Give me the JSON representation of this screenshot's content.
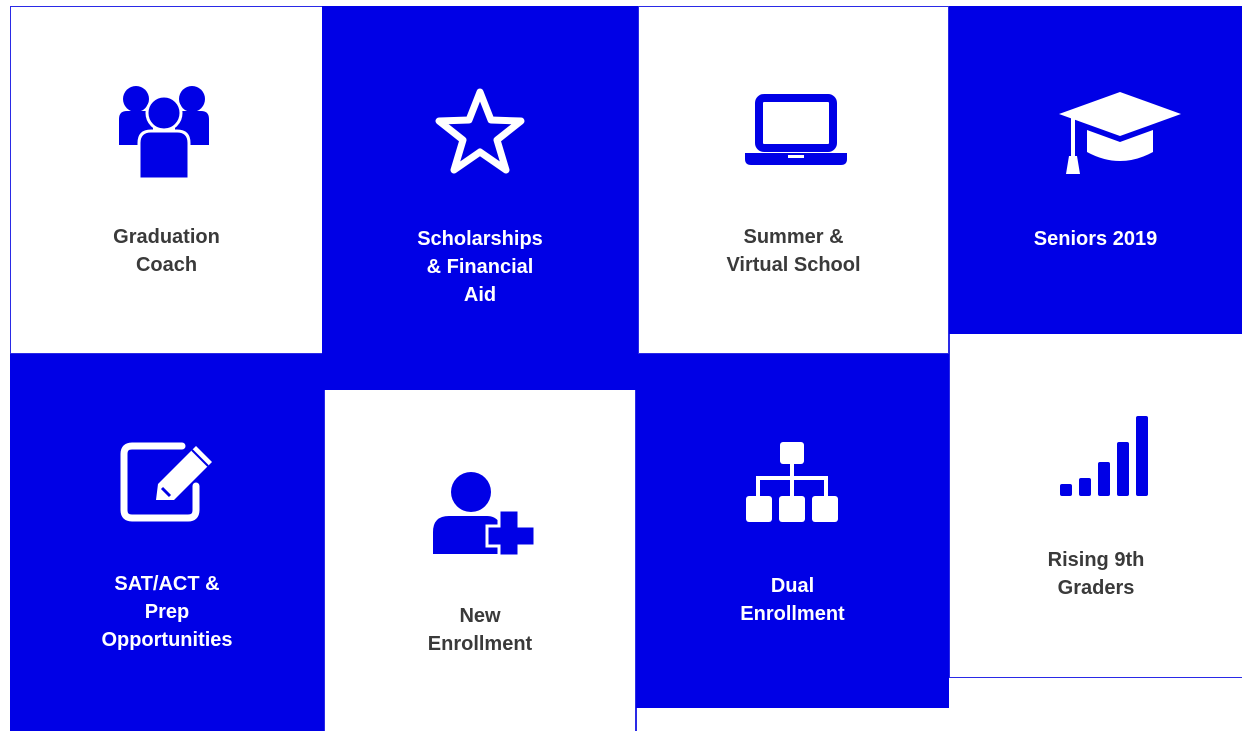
{
  "colors": {
    "accent": "#0000e6",
    "tile_white": "#ffffff",
    "text_dark": "#3a3a3a",
    "text_light": "#ffffff"
  },
  "tiles": [
    {
      "id": "graduation-coach",
      "icon": "group-icon",
      "lines": [
        "Graduation",
        "Coach"
      ]
    },
    {
      "id": "scholarships",
      "icon": "star-icon",
      "lines": [
        "Scholarships",
        "& Financial",
        "Aid"
      ]
    },
    {
      "id": "summer-virtual",
      "icon": "laptop-icon",
      "lines": [
        "Summer &",
        "Virtual School"
      ]
    },
    {
      "id": "seniors-2019",
      "icon": "graduation-cap-icon",
      "lines": [
        "Seniors 2019"
      ]
    },
    {
      "id": "sat-act",
      "icon": "edit-icon",
      "lines": [
        "SAT/ACT &",
        "Prep",
        "Opportunities"
      ]
    },
    {
      "id": "new-enrollment",
      "icon": "add-user-icon",
      "lines": [
        "New",
        "Enrollment"
      ]
    },
    {
      "id": "dual-enrollment",
      "icon": "sitemap-icon",
      "lines": [
        "Dual",
        "Enrollment"
      ]
    },
    {
      "id": "rising-9th",
      "icon": "signal-bars-icon",
      "lines": [
        "Rising 9th",
        "Graders"
      ]
    }
  ]
}
